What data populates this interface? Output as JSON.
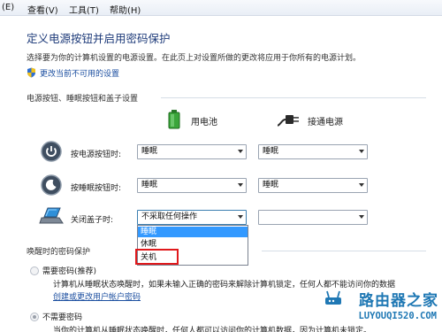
{
  "menu": {
    "items": [
      "(E)",
      "查看(V)",
      "工具(T)",
      "帮助(H)"
    ]
  },
  "page": {
    "title": "定义电源按钮并启用密码保护",
    "description": "选择要为你的计算机设置的电源设置。在此页上对设置所做的更改将应用于你所有的电源计划。",
    "change_link": "更改当前不可用的设置"
  },
  "buttons_section": {
    "heading": "电源按钮、睡眠按钮和盖子设置",
    "battery_label": "用电池",
    "plugged_label": "接通电源",
    "rows": [
      {
        "label": "按电源按钮时:",
        "battery": "睡眠",
        "plugged": "睡眠"
      },
      {
        "label": "按睡眠按钮时:",
        "battery": "睡眠",
        "plugged": "睡眠"
      },
      {
        "label": "关闭盖子时:",
        "battery": "不采取任何操作",
        "plugged": ""
      }
    ],
    "lid_dropdown_options": [
      "睡眠",
      "休眠",
      "关机"
    ],
    "lid_dropdown_selected": "睡眠"
  },
  "password_section": {
    "heading": "唤醒时的密码保护",
    "option_require": "需要密码(推荐)",
    "require_desc": "计算机从睡眠状态唤醒时，如果未输入正确的密码来解除计算机锁定，任何人都不能访问你的数据",
    "create_link": "创建或更改用户帐户密码",
    "option_no_require": "不需要密码",
    "no_require_desc": "当你的计算机从睡眠状态唤醒时，任何人都可以访问你的计算机数据，因为计算机未锁定。"
  },
  "watermark": {
    "title": "路由器之家",
    "url": "LUYOUQI520.COM"
  },
  "colors": {
    "title": "#1e3b7a",
    "link": "#1c4fa0",
    "selection": "#3399ff",
    "highlight": "#e0191c",
    "watermark": "#1f78b4"
  }
}
